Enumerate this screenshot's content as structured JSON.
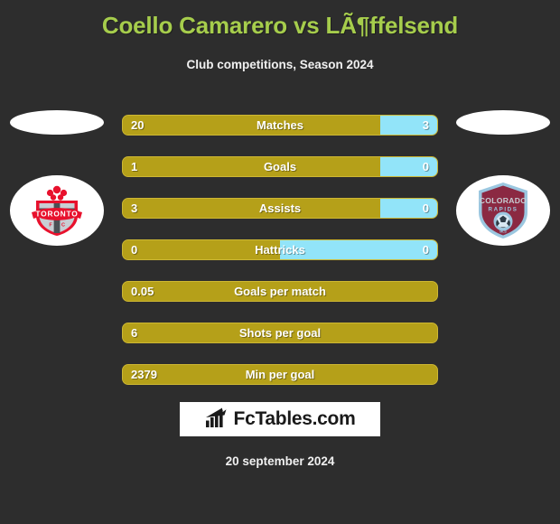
{
  "header": {
    "title": "Coello Camarero vs LÃ¶ffelsend",
    "subtitle": "Club competitions, Season 2024",
    "title_color": "#a6cd4c"
  },
  "teams": {
    "home": {
      "crest_name": "toronto-fc-crest",
      "crest_line1": "TORONTO",
      "crest_line2": "F",
      "crest_line3": "C",
      "crest_color": "#e8112d",
      "crest_secondary": "#c8ced4"
    },
    "away": {
      "crest_name": "colorado-rapids-crest",
      "crest_line1": "COLORADO",
      "crest_line2": "RAPIDS",
      "crest_color": "#8b2942",
      "crest_secondary": "#9bc7e0"
    }
  },
  "colors": {
    "background": "#2d2d2d",
    "home_bar": "#b5a019",
    "home_bar_border": "#cdb733",
    "away_bar": "#92e4f9",
    "text": "#ffffff",
    "accent": "#a6cd4c"
  },
  "footer": {
    "brand": "FcTables.com",
    "brand_icon": "bar-chart-growth-icon",
    "date": "20 september 2024"
  },
  "chart_data": {
    "type": "bar",
    "title": "Coello Camarero vs LÃ¶ffelsend",
    "subtitle": "Club competitions, Season 2024",
    "orientation": "horizontal-diverging",
    "xlabel": "",
    "ylabel": "",
    "legend_position": "none",
    "grid": false,
    "categories": [
      "Matches",
      "Goals",
      "Assists",
      "Hattricks",
      "Goals per match",
      "Shots per goal",
      "Min per goal"
    ],
    "series": [
      {
        "name": "Coello Camarero",
        "color": "#b5a019",
        "values": [
          "20",
          "1",
          "3",
          "0",
          "0.05",
          "6",
          "2379"
        ]
      },
      {
        "name": "LÃ¶ffelsend",
        "color": "#92e4f9",
        "values": [
          "3",
          "0",
          "0",
          "0",
          null,
          null,
          null
        ]
      }
    ],
    "rows": [
      {
        "label": "Matches",
        "home": "20",
        "away": "3",
        "home_pct": 82,
        "split": true
      },
      {
        "label": "Goals",
        "home": "1",
        "away": "0",
        "home_pct": 82,
        "split": true
      },
      {
        "label": "Assists",
        "home": "3",
        "away": "0",
        "home_pct": 82,
        "split": true
      },
      {
        "label": "Hattricks",
        "home": "0",
        "away": "0",
        "home_pct": 50,
        "split": true
      },
      {
        "label": "Goals per match",
        "home": "0.05",
        "away": "",
        "home_pct": 100,
        "split": false
      },
      {
        "label": "Shots per goal",
        "home": "6",
        "away": "",
        "home_pct": 100,
        "split": false
      },
      {
        "label": "Min per goal",
        "home": "2379",
        "away": "",
        "home_pct": 100,
        "split": false
      }
    ]
  }
}
